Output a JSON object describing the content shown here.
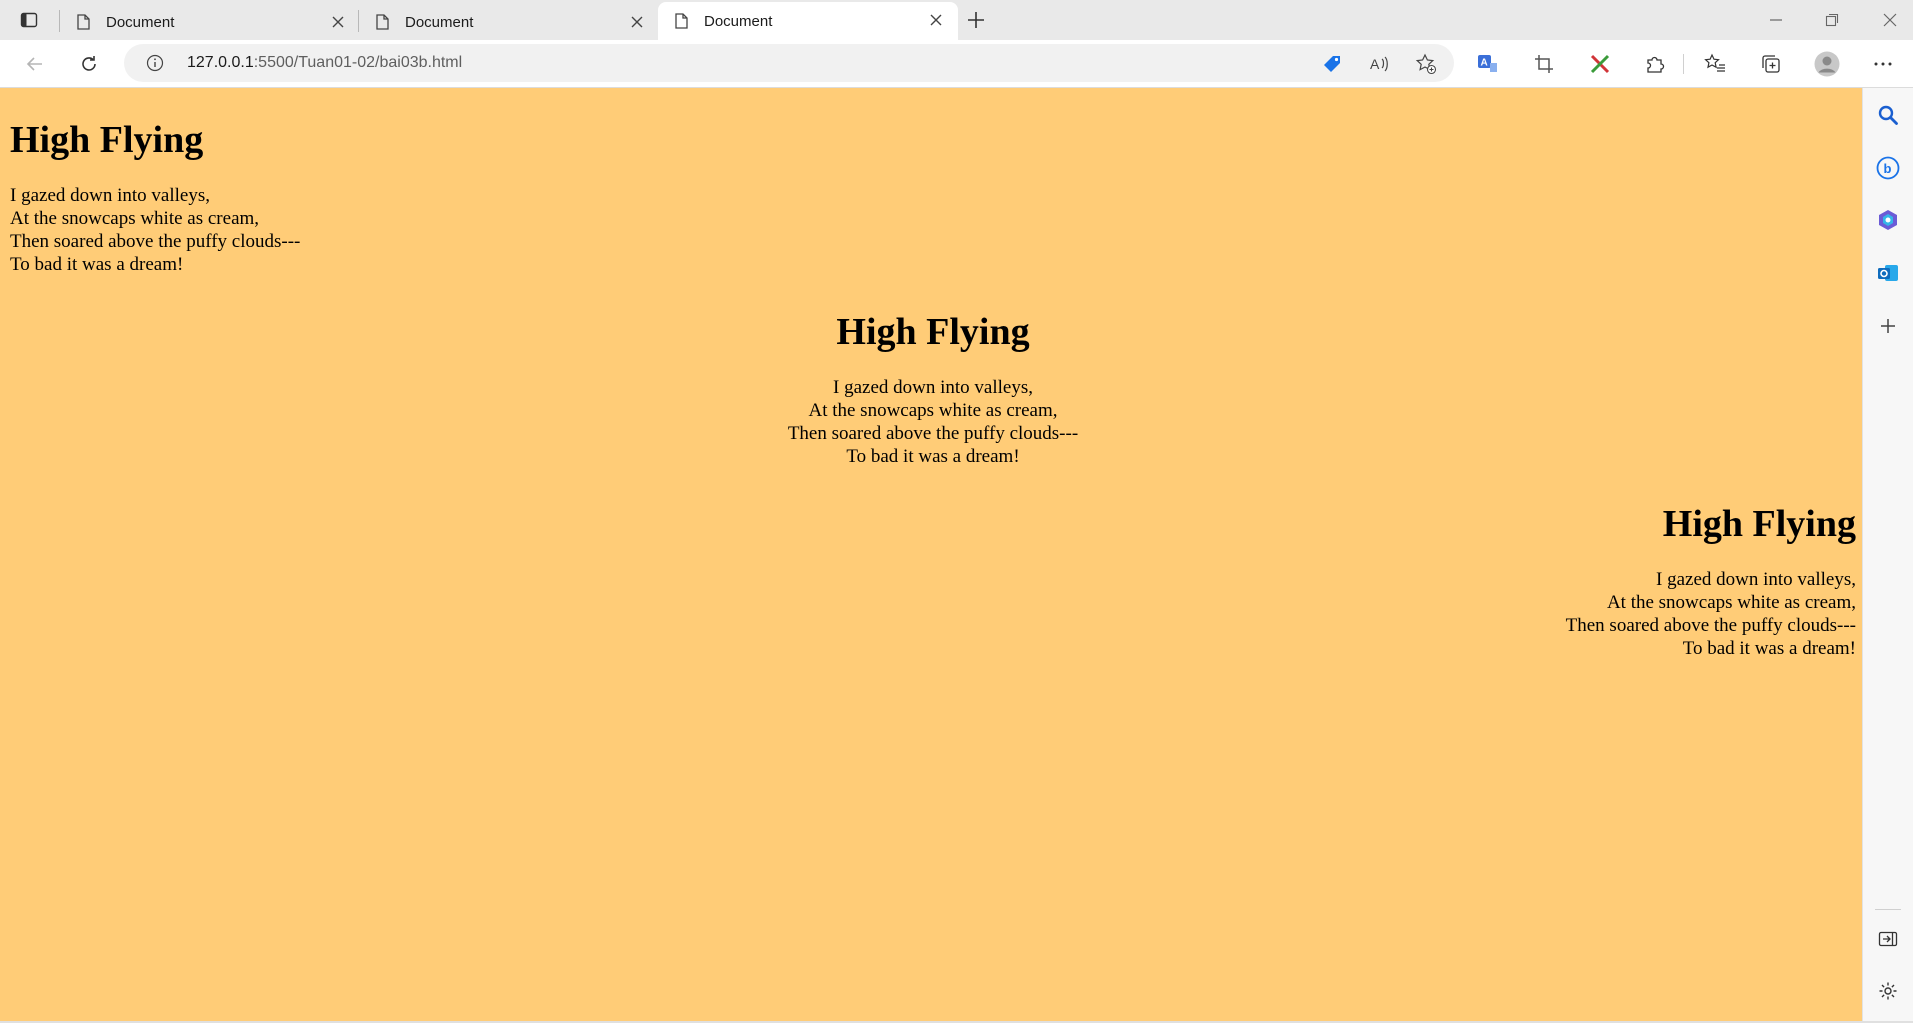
{
  "tabs": [
    {
      "title": "Document",
      "active": false
    },
    {
      "title": "Document",
      "active": false
    },
    {
      "title": "Document",
      "active": true
    }
  ],
  "address_bar": {
    "url_host": "127.0.0.1",
    "url_rest": ":5500/Tuan01-02/bai03b.html"
  },
  "page": {
    "background": "#ffcc77",
    "poems": [
      {
        "align": "left",
        "heading": "High Flying",
        "lines": [
          "I gazed down into valleys,",
          "At the snowcaps white as cream,",
          "Then soared above the puffy clouds---",
          "To bad it was a dream!"
        ]
      },
      {
        "align": "center",
        "heading": "High Flying",
        "lines": [
          "I gazed down into valleys,",
          "At the snowcaps white as cream,",
          "Then soared above the puffy clouds---",
          "To bad it was a dream!"
        ]
      },
      {
        "align": "right",
        "heading": "High Flying",
        "lines": [
          "I gazed down into valleys,",
          "At the snowcaps white as cream,",
          "Then soared above the puffy clouds---",
          "To bad it was a dream!"
        ]
      }
    ]
  },
  "icons": {
    "tab_actions": "tab-actions-icon",
    "new_tab": "plus-icon",
    "back": "back-arrow-icon",
    "refresh": "refresh-icon",
    "site_info": "info-icon",
    "coupon": "tag-icon",
    "read_aloud": "read-aloud-icon",
    "favorite_add": "star-add-icon",
    "translate": "translate-icon",
    "screenshot": "crop-icon",
    "extension_tool": "tools-extension-icon",
    "extensions": "puzzle-icon",
    "favorites": "favorites-icon",
    "collections": "collections-icon",
    "profile": "avatar-icon",
    "more": "ellipsis-icon",
    "sidebar_search": "search-icon",
    "sidebar_bing": "bing-icon",
    "sidebar_copilot": "copilot-icon",
    "sidebar_outlook": "outlook-icon",
    "sidebar_add": "plus-icon",
    "sidebar_hide": "hide-sidebar-icon",
    "sidebar_settings": "gear-icon"
  },
  "colors": {
    "accent": "#0f6cbd",
    "page_background": "#ffcc77"
  }
}
